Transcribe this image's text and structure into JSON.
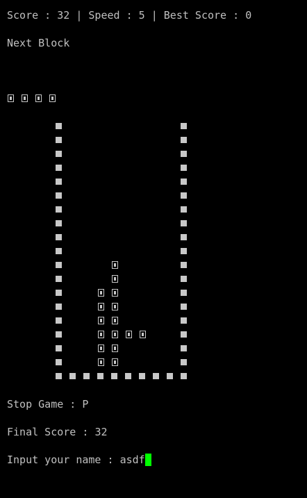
{
  "header": {
    "score_label": "Score",
    "score": "32",
    "speed_label": "Speed",
    "speed": "5",
    "best_label": "Best Score",
    "best": "0"
  },
  "next_block": {
    "label": "Next Block",
    "cells": [
      [
        0,
        0
      ],
      [
        1,
        0
      ],
      [
        2,
        0
      ],
      [
        3,
        0
      ]
    ]
  },
  "board": {
    "rows": 19,
    "cols": 10,
    "settled_cells": [
      [
        4,
        10
      ],
      [
        4,
        11
      ],
      [
        3,
        12
      ],
      [
        4,
        12
      ],
      [
        3,
        13
      ],
      [
        4,
        13
      ],
      [
        3,
        14
      ],
      [
        4,
        14
      ],
      [
        3,
        15
      ],
      [
        4,
        15
      ],
      [
        5,
        15
      ],
      [
        6,
        15
      ],
      [
        3,
        16
      ],
      [
        4,
        16
      ],
      [
        3,
        17
      ],
      [
        4,
        17
      ]
    ]
  },
  "footer": {
    "stop_label": "Stop Game",
    "stop_key": "P",
    "final_label": "Final Score",
    "final_score": "32",
    "input_prompt": "Input your name",
    "input_value": "asdf"
  },
  "colors": {
    "background": "#000000",
    "text": "#c0c0c0",
    "block": "#c8c8c8",
    "cursor": "#00ff00"
  }
}
